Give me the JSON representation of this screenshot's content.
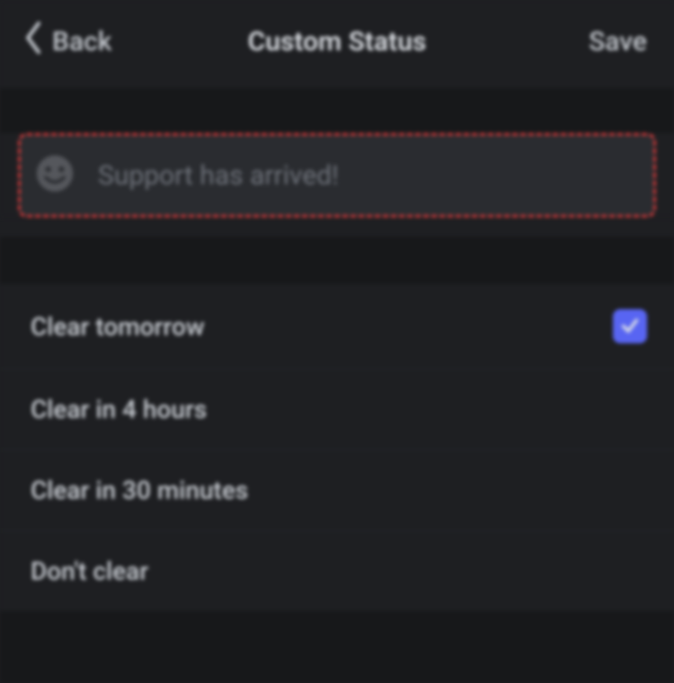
{
  "header": {
    "back_label": "Back",
    "title": "Custom Status",
    "save_label": "Save"
  },
  "status": {
    "placeholder": "Support has arrived!",
    "value": "",
    "icon_name": "smile-icon"
  },
  "clear_options": [
    {
      "label": "Clear tomorrow",
      "selected": true
    },
    {
      "label": "Clear in 4 hours",
      "selected": false
    },
    {
      "label": "Clear in 30 minutes",
      "selected": false
    },
    {
      "label": "Don't clear",
      "selected": false
    }
  ],
  "colors": {
    "accent": "#5865f2",
    "highlight_border": "#d63838"
  }
}
